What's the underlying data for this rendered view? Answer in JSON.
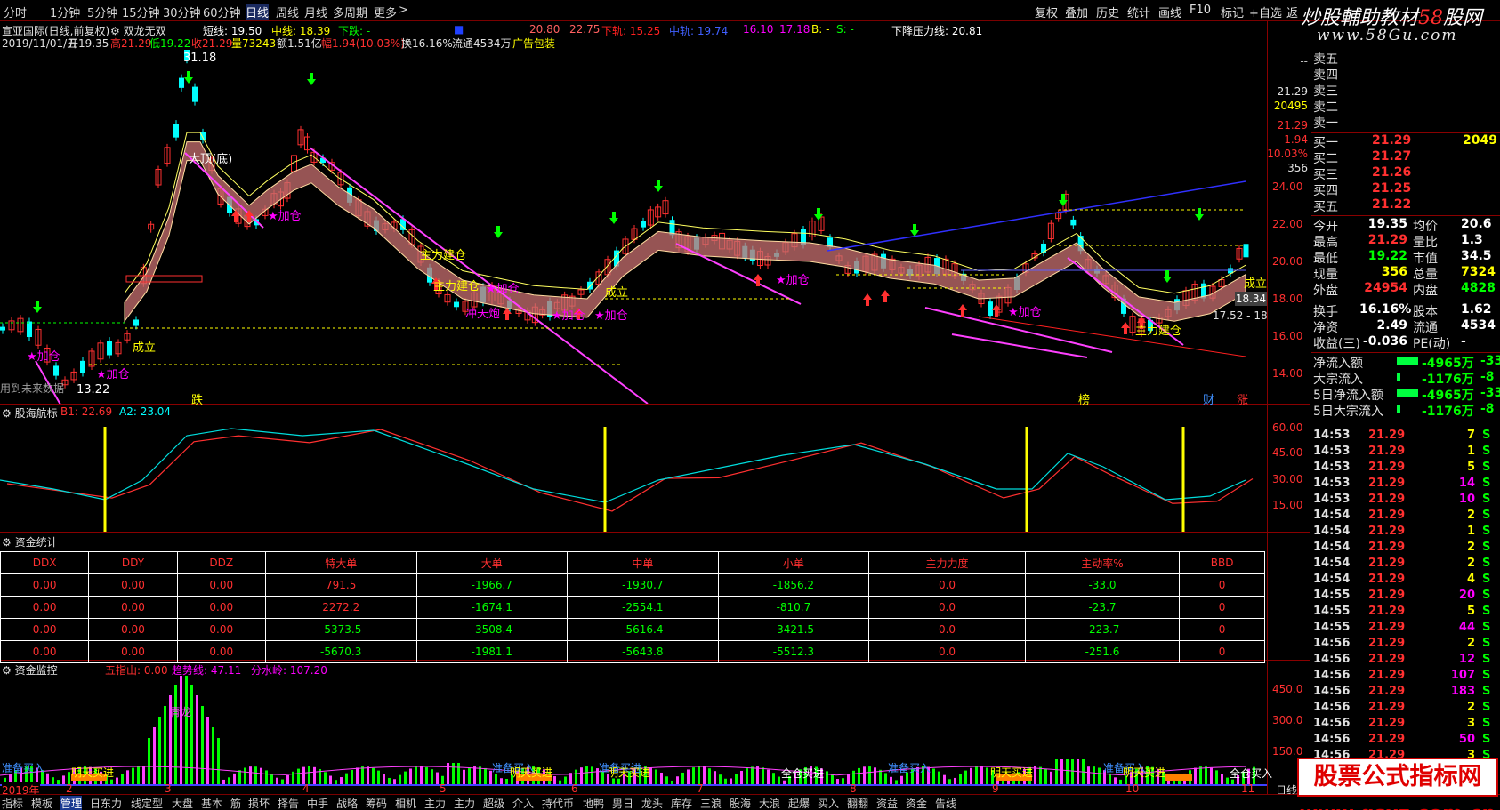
{
  "topbar": {
    "periods": [
      "分时",
      "1分钟",
      "5分钟",
      "15分钟",
      "30分钟",
      "60分钟",
      "日线",
      "周线",
      "月线",
      "多周期",
      "更多"
    ],
    "active_period": "日线",
    "right_buttons": [
      "复权",
      "叠加",
      "历史",
      "统计",
      "画线",
      "F10",
      "标记",
      "+自选",
      "返"
    ]
  },
  "watermark": {
    "site_cn_a": "炒股輔助教材",
    "site_cn_b": "58",
    "site_cn_c": "股网",
    "url": "www.58Gu.com",
    "bottom_a": "股票公式指标网",
    "bottom_url": "www.gsxz.com.cn"
  },
  "header": {
    "stock": "宣亚国际(日线,前复权)",
    "indicator": "双龙无双",
    "short_label": "短线: 19.50",
    "mid_label": "中线: 18.39",
    "down_label": "下跌: -",
    "level1": "20.80",
    "level2": "22.75",
    "down_rail": "下轨: 15.25",
    "mid_rail": "中轨: 19.74",
    "v1": "16.10",
    "v2": "17.18",
    "b_label": "B: -",
    "s_label": "S: -",
    "resist": "下降压力线: 20.81"
  },
  "ohlc": {
    "date": "2019/11/01/五",
    "open": "开19.35",
    "high": "高21.29",
    "low": "低19.22",
    "close": "收21.29",
    "vol": "量73243",
    "amount": "额1.51亿",
    "change": "幅1.94(10.03%)",
    "turnover": "换16.16%",
    "float": "流通4534万",
    "sector": "广告包装"
  },
  "main_chart": {
    "y_ticks": [
      "24.00",
      "22.00",
      "20.00",
      "18.00",
      "16.00",
      "14.00"
    ],
    "price_tags": [
      "18.34"
    ],
    "labels": {
      "peak": "31.18",
      "low": "13.22",
      "top": "大顶(底)",
      "build1": "主力建仓",
      "build2": "主力建仓",
      "build3": "主力建仓",
      "rise": "冲天炮",
      "add": "加仓",
      "done": "成立",
      "future": "用到未来数据",
      "range": "17.52 - 18",
      "fall": "跌",
      "bang": "榜",
      "cai": "财",
      "zhang": "涨",
      "sell": "卖"
    },
    "side": {
      "dash1": "--",
      "dash2": "--",
      "p1": "21.29",
      "p2": "20495",
      "p3": "21.29",
      "p4": "1.94",
      "p5": "10.03%",
      "p6": "356"
    }
  },
  "osc": {
    "name": "股海航标",
    "b1": "B1: 22.69",
    "a2": "A2: 23.04",
    "ticks": [
      "60.00",
      "45.00",
      "30.00",
      "15.00"
    ]
  },
  "funds_table": {
    "title": "资金统计",
    "headers": [
      "DDX",
      "DDY",
      "DDZ",
      "特大单",
      "大单",
      "中单",
      "小单",
      "主力力度",
      "主动率%",
      "BBD"
    ],
    "rows": [
      [
        "0.00",
        "0.00",
        "0.00",
        "791.5",
        "-1966.7",
        "-1930.7",
        "-1856.2",
        "0.0",
        "-33.0",
        "0"
      ],
      [
        "0.00",
        "0.00",
        "0.00",
        "2272.2",
        "-1674.1",
        "-2554.1",
        "-810.7",
        "0.0",
        "-23.7",
        "0"
      ],
      [
        "0.00",
        "0.00",
        "0.00",
        "-5373.5",
        "-3508.4",
        "-5616.4",
        "-3421.5",
        "0.0",
        "-223.7",
        "0"
      ],
      [
        "0.00",
        "0.00",
        "0.00",
        "-5670.3",
        "-1981.1",
        "-5643.8",
        "-5512.3",
        "0.0",
        "-251.6",
        "0"
      ]
    ]
  },
  "monitor": {
    "title": "资金监控",
    "m1": "五指山: 0.00",
    "m2": "趋势线: 47.11",
    "m3": "分水岭: 107.20",
    "ticks": [
      "450.0",
      "300.0",
      "150.0"
    ],
    "labels": [
      "准备买入",
      "明天买进",
      "青龙",
      "准备买入",
      "明天买进",
      "准备买进",
      "明天买进",
      "全仓买进",
      "准备买入",
      "明天买进",
      "准备买入",
      "明天买进",
      "全仓买入"
    ]
  },
  "date_axis": {
    "year": "2019年",
    "months": [
      "2",
      "3",
      "4",
      "5",
      "6",
      "7",
      "8",
      "9",
      "10",
      "11"
    ],
    "right": "日线"
  },
  "quote": {
    "sells": [
      "卖五",
      "卖四",
      "卖三",
      "卖二",
      "卖一"
    ],
    "buys": [
      {
        "label": "买一",
        "price": "21.29",
        "vol": "2049"
      },
      {
        "label": "买二",
        "price": "21.27",
        "vol": ""
      },
      {
        "label": "买三",
        "price": "21.26",
        "vol": ""
      },
      {
        "label": "买四",
        "price": "21.25",
        "vol": ""
      },
      {
        "label": "买五",
        "price": "21.22",
        "vol": ""
      }
    ],
    "stats": [
      {
        "l1": "今开",
        "v1": "19.35",
        "l2": "均价",
        "v2": "20.6"
      },
      {
        "l1": "最高",
        "v1": "21.29",
        "l2": "量比",
        "v2": "1.3"
      },
      {
        "l1": "最低",
        "v1": "19.22",
        "l2": "市值",
        "v2": "34.5"
      },
      {
        "l1": "现量",
        "v1": "356",
        "l2": "总量",
        "v2": "7324"
      },
      {
        "l1": "外盘",
        "v1": "24954",
        "l2": "内盘",
        "v2": "4828"
      }
    ],
    "stats2": [
      {
        "l1": "换手",
        "v1": "16.16%",
        "l2": "股本",
        "v2": "1.62"
      },
      {
        "l1": "净资",
        "v1": "2.49",
        "l2": "流通",
        "v2": "4534"
      },
      {
        "l1": "收益(三)",
        "v1": "-0.036",
        "l2": "PE(动)",
        "v2": "-"
      }
    ],
    "flows": [
      {
        "l": "净流入额",
        "v": "-4965万",
        "v2": "-33"
      },
      {
        "l": "大宗流入",
        "v": "-1176万",
        "v2": "-8"
      },
      {
        "l": "5日净流入额",
        "v": "-4965万",
        "v2": "-33"
      },
      {
        "l": "5日大宗流入",
        "v": "-1176万",
        "v2": "-8"
      }
    ]
  },
  "ticks": [
    {
      "t": "14:53",
      "p": "21.29",
      "v": "7",
      "s": "S"
    },
    {
      "t": "14:53",
      "p": "21.29",
      "v": "1",
      "s": "S"
    },
    {
      "t": "14:53",
      "p": "21.29",
      "v": "5",
      "s": "S"
    },
    {
      "t": "14:53",
      "p": "21.29",
      "v": "14",
      "s": "S"
    },
    {
      "t": "14:53",
      "p": "21.29",
      "v": "10",
      "s": "S"
    },
    {
      "t": "14:54",
      "p": "21.29",
      "v": "2",
      "s": "S"
    },
    {
      "t": "14:54",
      "p": "21.29",
      "v": "1",
      "s": "S"
    },
    {
      "t": "14:54",
      "p": "21.29",
      "v": "2",
      "s": "S"
    },
    {
      "t": "14:54",
      "p": "21.29",
      "v": "2",
      "s": "S"
    },
    {
      "t": "14:54",
      "p": "21.29",
      "v": "4",
      "s": "S"
    },
    {
      "t": "14:55",
      "p": "21.29",
      "v": "20",
      "s": "S"
    },
    {
      "t": "14:55",
      "p": "21.29",
      "v": "5",
      "s": "S"
    },
    {
      "t": "14:55",
      "p": "21.29",
      "v": "44",
      "s": "S"
    },
    {
      "t": "14:56",
      "p": "21.29",
      "v": "2",
      "s": "S"
    },
    {
      "t": "14:56",
      "p": "21.29",
      "v": "12",
      "s": "S"
    },
    {
      "t": "14:56",
      "p": "21.29",
      "v": "107",
      "s": "S"
    },
    {
      "t": "14:56",
      "p": "21.29",
      "v": "183",
      "s": "S"
    },
    {
      "t": "14:56",
      "p": "21.29",
      "v": "2",
      "s": "S"
    },
    {
      "t": "14:56",
      "p": "21.29",
      "v": "3",
      "s": "S"
    },
    {
      "t": "14:56",
      "p": "21.29",
      "v": "50",
      "s": "S"
    },
    {
      "t": "14:56",
      "p": "21.29",
      "v": "3",
      "s": "S"
    }
  ],
  "bottombar": {
    "tabs": [
      "指标",
      "模板",
      "管理",
      "日东力",
      "线定型",
      "大盘",
      "基本",
      "筋",
      "损坏",
      "择告",
      "中手",
      "战略",
      "筹码",
      "相机",
      "主力",
      "主力",
      "超级",
      "介入",
      "持代币",
      "地鸭",
      "男日",
      "龙头",
      "库存",
      "三浪",
      "股海",
      "大浪",
      "起爆",
      "买入",
      "翻翻",
      "资益",
      "资金",
      "告线"
    ],
    "active": "管理"
  },
  "colors": {
    "up": "#ff3030",
    "down": "#00ffff",
    "yellow": "#ffff00",
    "magenta": "#ff00ff",
    "green": "#00ff00"
  }
}
